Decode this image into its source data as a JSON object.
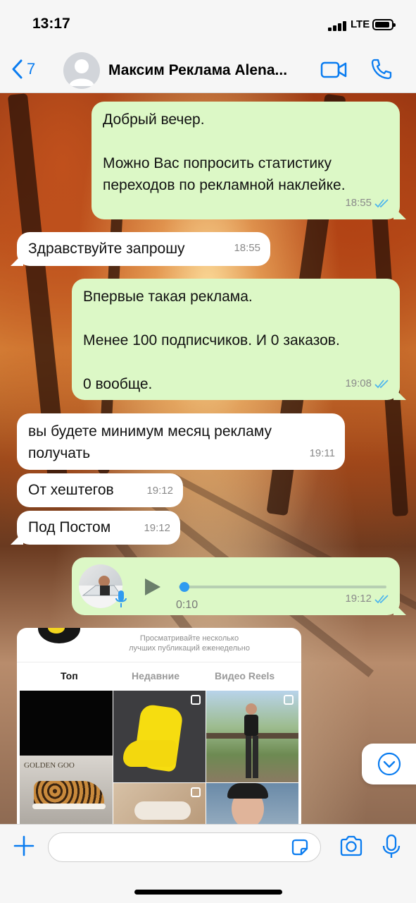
{
  "status_bar": {
    "time": "13:17",
    "network": "LTE"
  },
  "header": {
    "back_count": "7",
    "contact_name": "Максим Реклама Alena..."
  },
  "messages": [
    {
      "direction": "out",
      "lines": [
        "Добрый вечер.",
        "",
        "Можно Вас попросить статистику",
        "переходов по рекламной наклейке."
      ],
      "time": "18:55",
      "read": true
    },
    {
      "direction": "in",
      "lines": [
        "Здравствуйте запрошу"
      ],
      "time": "18:55"
    },
    {
      "direction": "out",
      "lines": [
        "Впервые такая реклама.",
        "",
        "Менее 100 подписчиков. И 0 заказов.",
        "",
        "0 вообще."
      ],
      "time": "19:08",
      "read": true
    },
    {
      "direction": "in",
      "lines": [
        "вы будете минимум месяц рекламу",
        "получать"
      ],
      "time": "19:11"
    },
    {
      "direction": "in",
      "lines": [
        "От хештегов"
      ],
      "time": "19:12"
    },
    {
      "direction": "in",
      "lines": [
        "Под Постом"
      ],
      "time": "19:12"
    },
    {
      "direction": "out",
      "type": "voice",
      "duration": "0:10",
      "time": "19:12",
      "read": true,
      "progress": 0.02
    }
  ],
  "shared_screenshot": {
    "caption_line1": "Просматривайте несколько",
    "caption_line2": "лучших публикаций еженедельно",
    "tabs": [
      "Топ",
      "Недавние",
      "Видео Reels"
    ],
    "active_tab": "Топ",
    "photo_text": "GOLDEN GOO"
  },
  "input": {
    "placeholder": "",
    "value": ""
  },
  "colors": {
    "accent": "#0a7cf0",
    "outgoing_bubble": "#dcf8c6",
    "incoming_bubble": "#ffffff",
    "read_ticks": "#4fb6ec"
  },
  "icons": [
    "back-chevron-icon",
    "video-call-icon",
    "phone-icon",
    "double-check-icon",
    "play-icon",
    "mic-icon",
    "chevron-down-icon",
    "plus-icon",
    "sticker-icon",
    "camera-icon"
  ]
}
